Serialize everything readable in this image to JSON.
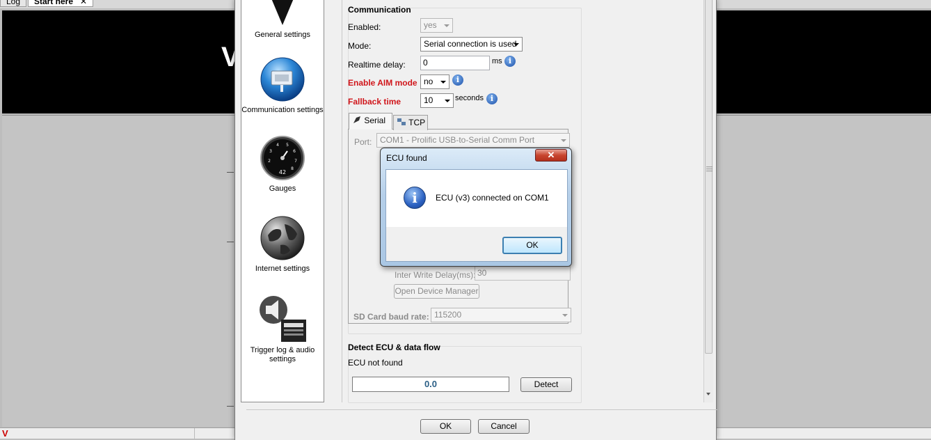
{
  "background": {
    "tabs": [
      {
        "label": "Log"
      },
      {
        "label": "Start here",
        "close": "✕"
      }
    ]
  },
  "nav": {
    "items": [
      {
        "label": "General settings"
      },
      {
        "label": "Communication settings"
      },
      {
        "label": "Gauges",
        "gauge_value": "42"
      },
      {
        "label": "Internet settings"
      },
      {
        "label": "Trigger log & audio settings"
      }
    ]
  },
  "communication": {
    "title": "Communication",
    "enabled_label": "Enabled:",
    "enabled_value": "yes",
    "mode_label": "Mode:",
    "mode_value": "Serial connection is used",
    "realtime_label": "Realtime delay:",
    "realtime_value": "0",
    "realtime_unit": "ms",
    "aim_label": "Enable AIM mode",
    "aim_value": "no",
    "fallback_label": "Fallback time",
    "fallback_value": "10",
    "fallback_unit": "seconds",
    "tabs": [
      {
        "label": "Serial"
      },
      {
        "label": "TCP"
      }
    ],
    "port_label": "Port:",
    "port_value": "COM1 - Prolific USB-to-Serial Comm Port",
    "inter_write_label": "Inter Write Delay(ms):",
    "inter_write_value": "30",
    "open_device_manager": "Open Device Manager",
    "sd_baud_label": "SD Card baud rate:",
    "sd_baud_value": "115200"
  },
  "detect": {
    "title": "Detect ECU & data flow",
    "status": "ECU not found",
    "progress_value": "0.0",
    "detect_button": "Detect"
  },
  "footer": {
    "ok": "OK",
    "cancel": "Cancel"
  },
  "msgbox": {
    "title": "ECU found",
    "close": "✕",
    "message": "ECU (v3) connected on COM1",
    "ok": "OK",
    "info_glyph": "i"
  },
  "colors": {
    "accent_red": "#d0161b",
    "info_blue": "#1b4fa8",
    "progress_text": "#2b5f86"
  }
}
